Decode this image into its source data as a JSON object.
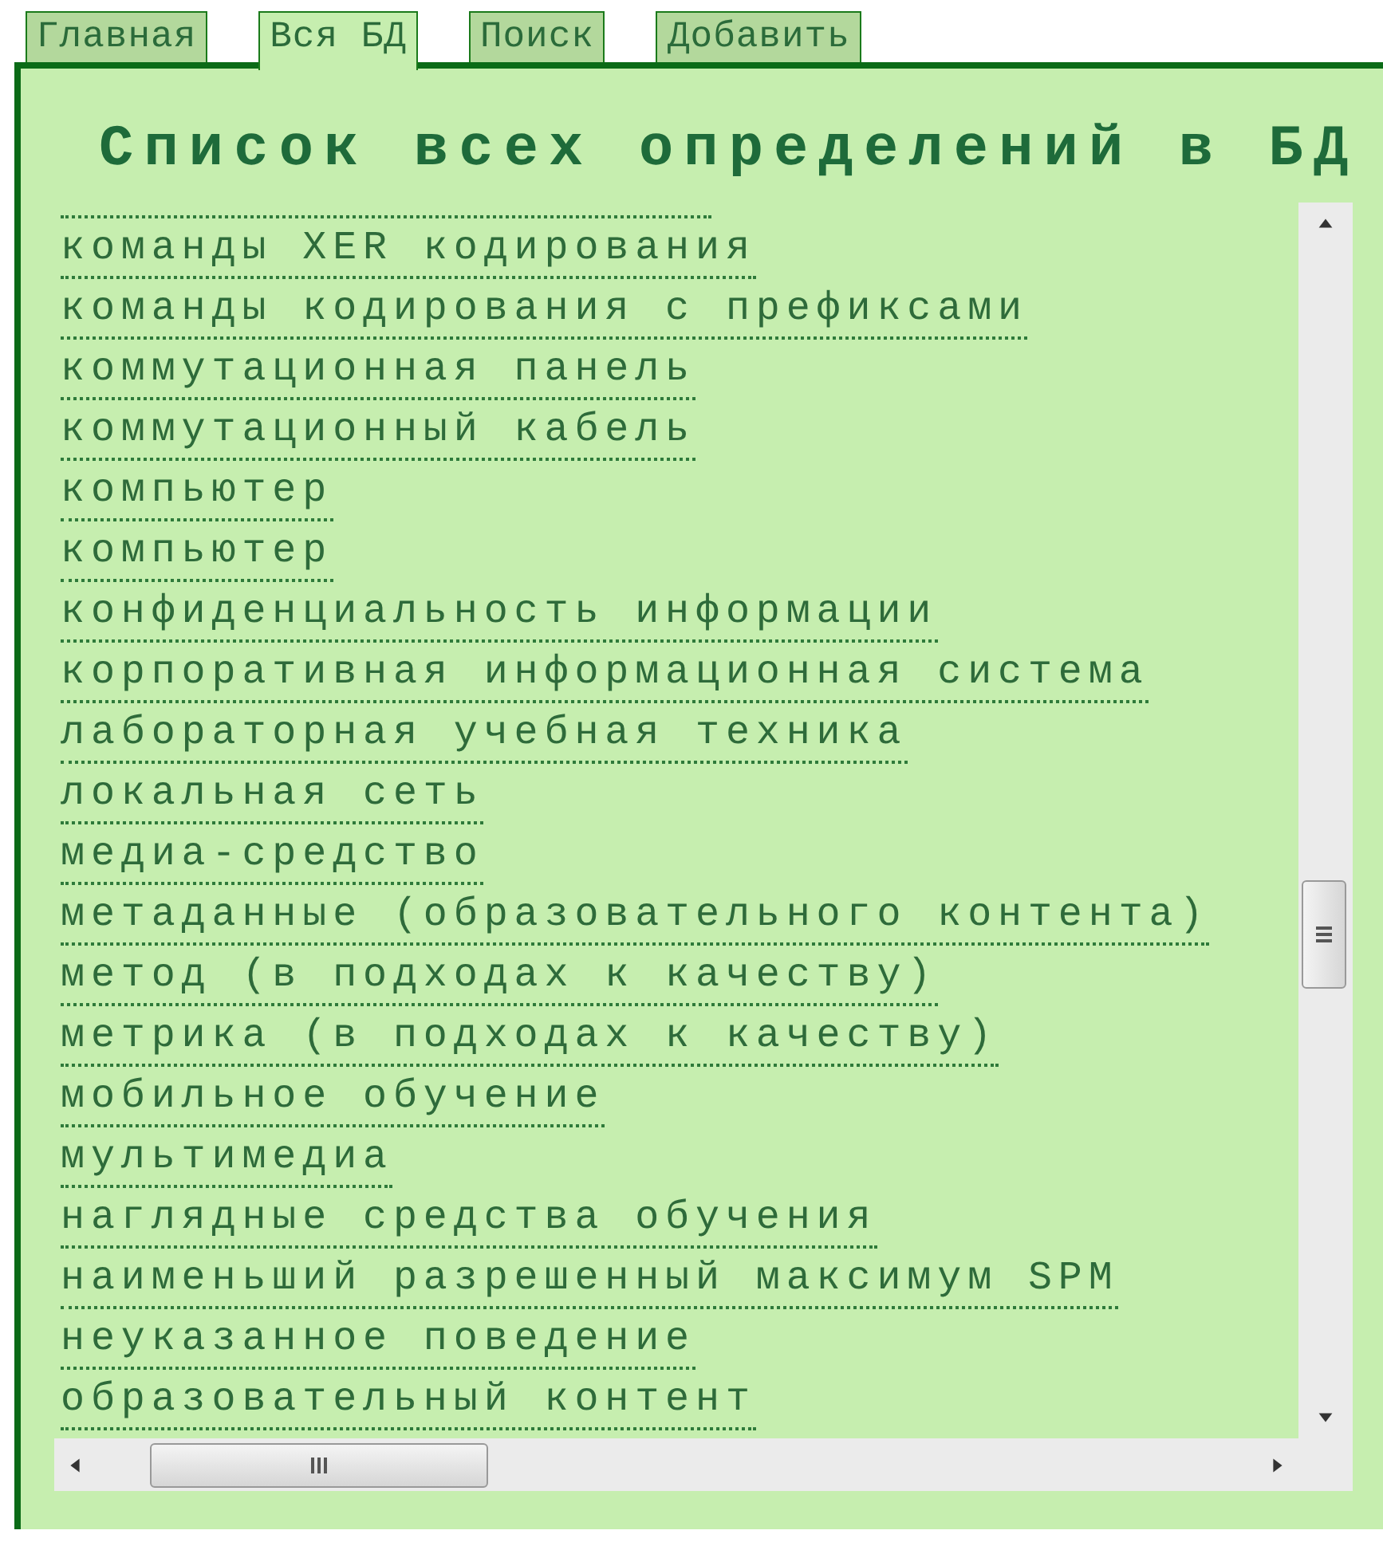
{
  "tabs": [
    {
      "label": "Главная",
      "selected": false
    },
    {
      "label": "Вся БД",
      "selected": true
    },
    {
      "label": "Поиск",
      "selected": false
    },
    {
      "label": "Добавить",
      "selected": false
    }
  ],
  "heading": "Список всех определений в БД",
  "terms": [
    "команды XER кодирования",
    "команды кодирования с префиксами",
    "коммутационная панель",
    "коммутационный кабель",
    "компьютер",
    "компьютер",
    "конфиденциальность информации",
    "корпоративная информационная система",
    "лабораторная учебная техника",
    "локальная сеть",
    "медиа-средство",
    "метаданные (образовательного контента)",
    "метод (в подходах к качеству)",
    "метрика (в подходах к качеству)",
    "мобильное обучение",
    "мультимедиа",
    "наглядные средства обучения",
    "наименьший разрешенный максимум SPM",
    "неуказанное поведение",
    "образовательный контент"
  ]
}
